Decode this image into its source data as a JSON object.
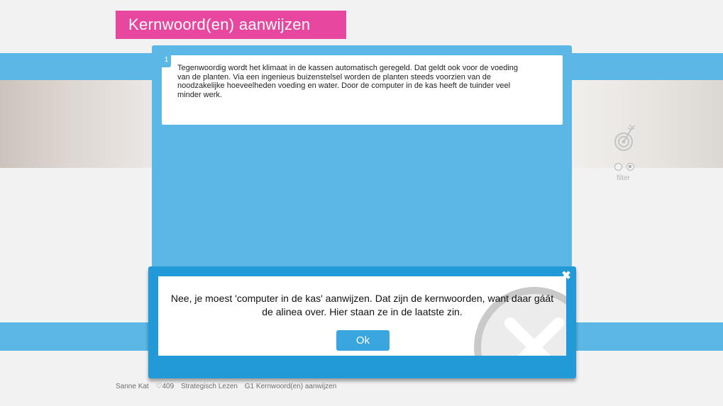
{
  "header": {
    "title": "Kernwoord(en) aanwijzen"
  },
  "content": {
    "paragraph_number": "1",
    "paragraph_lines": [
      "Tegenwoordig wordt het klimaat in de kassen automatisch geregeld. Dat geldt ook voor de voeding",
      "van de planten. Via een ingenieus buizenstelsel worden de planten steeds voorzien van de",
      "noodzakelijke hoeveelheden voeding en water. Door de computer in de kas heeft de tuinder veel",
      "minder werk."
    ]
  },
  "side_tools": {
    "filter_label": "filter"
  },
  "feedback_dialog": {
    "message_lines": [
      "Nee, je moest 'computer in de kas' aanwijzen. Dat zijn de kernwoorden, want daar gáát",
      "de alinea over. Hier staan ze in de laatste zin."
    ],
    "ok_label": "Ok",
    "close_icon": "✖"
  },
  "footer": {
    "user": "Sanne Kat",
    "points": "♡409",
    "module": "Strategisch Lezen",
    "exercise": "G1 Kernwoord(en) aanwijzen"
  },
  "colors": {
    "accent_blue": "#5ab7e6",
    "dialog_blue": "#229ad7",
    "title_pink": "#e8479f",
    "background": "#f2f2f2"
  },
  "icons": [
    "target-icon",
    "radio-unselected",
    "radio-selected",
    "close-icon",
    "wrong-x-icon"
  ]
}
